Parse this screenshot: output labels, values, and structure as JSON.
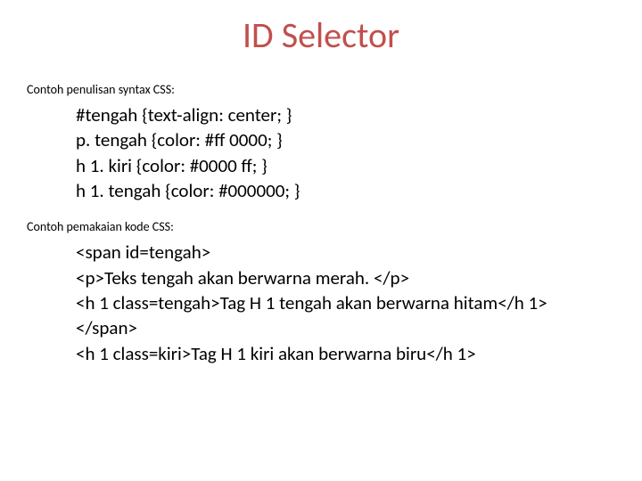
{
  "title": "ID Selector",
  "label1": "Contoh penulisan syntax CSS:",
  "css_lines": [
    "#tengah {text-align: center; }",
    "p. tengah {color: #ff 0000; }",
    "h 1. kiri {color: #0000 ff; }",
    "h 1. tengah {color: #000000; }"
  ],
  "label2": "Contoh pemakaian kode CSS:",
  "html_lines": [
    "<span id=tengah>",
    "<p>Teks tengah akan berwarna merah. </p>",
    "<h 1 class=tengah>Tag H 1 tengah akan berwarna hitam</h 1>",
    "</span>",
    "<h 1 class=kiri>Tag H 1 kiri akan berwarna biru</h 1>"
  ]
}
